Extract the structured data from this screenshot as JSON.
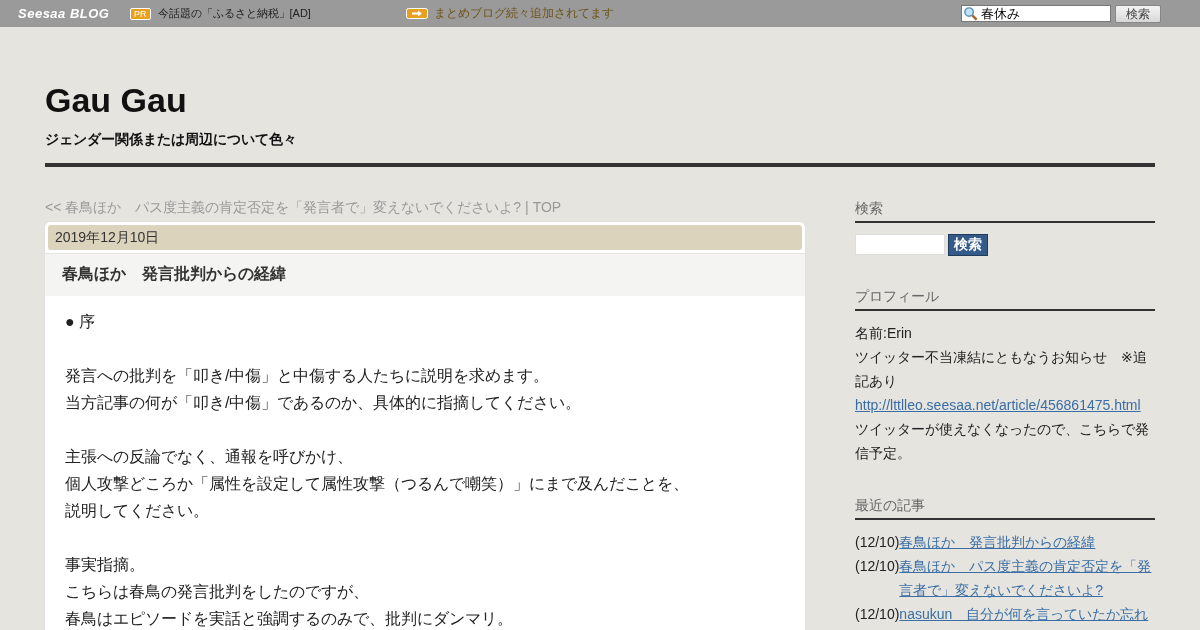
{
  "top_bar": {
    "logo": "Seesaa BLOG",
    "pr_badge": "PR",
    "ad_link": "今話題の「ふるさと納税」[AD]",
    "notice": "まとめブログ続々追加されてます",
    "search": {
      "value": "春休み"
    },
    "search_button": "検索"
  },
  "blog": {
    "title": "Gau Gau",
    "subtitle": "ジェンダー関係または周辺について色々"
  },
  "nav": {
    "prev": "<< 春鳥ほか　パス度主義の肯定否定を「発言者で」変えないでくださいよ?",
    "separator": "|",
    "top": "TOP"
  },
  "article": {
    "date": "2019年12月10日",
    "title": "春鳥ほか　発言批判からの経緯",
    "paragraphs": [
      [
        "● 序"
      ],
      [
        "発言への批判を「叩き/中傷」と中傷する人たちに説明を求めます。",
        "当方記事の何が「叩き/中傷」であるのか、具体的に指摘してください。"
      ],
      [
        "主張への反論でなく、通報を呼びかけ、",
        "個人攻撃どころか「属性を設定して属性攻撃（つるんで嘲笑）」にまで及んだことを、",
        "説明してください。"
      ],
      [
        "事実指摘。",
        "こちらは春鳥の発言批判をしたのですが、",
        "春鳥はエピソードを実話と強調するのみで、批判にダンマリ。"
      ]
    ]
  },
  "sidebar": {
    "search": {
      "heading": "検索",
      "button": "検索"
    },
    "profile": {
      "heading": "プロフィール",
      "items": [
        {
          "kind": "text",
          "text": "名前:Erin"
        },
        {
          "kind": "text",
          "text": "ツイッター不当凍結にともなうお知らせ　※追記あり"
        },
        {
          "kind": "link",
          "text": "http://lttlleo.seesaa.net/article/456861475.html"
        },
        {
          "kind": "text",
          "text": "ツイッターが使えなくなったので、こちらで発信予定。"
        }
      ]
    },
    "recent": {
      "heading": "最近の記事",
      "items": [
        {
          "date": "(12/10)",
          "title": "春鳥ほか　発言批判からの経緯"
        },
        {
          "date": "(12/10)",
          "title": "春鳥ほか　パス度主義の肯定否定を「発言者で」変えないでくださいよ?"
        },
        {
          "date": "(12/10)",
          "title": "nasukun　自分が何を言っていたか忘れ"
        }
      ]
    }
  }
}
